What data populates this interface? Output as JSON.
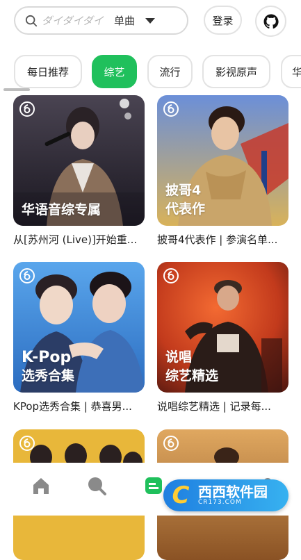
{
  "header": {
    "search_placeholder": "ダイダイダイ",
    "search_type": "单曲",
    "login_label": "登录"
  },
  "tabs": [
    {
      "label": "每日推荐"
    },
    {
      "label": "综艺",
      "active": true
    },
    {
      "label": "流行"
    },
    {
      "label": "影视原声"
    },
    {
      "label": "华"
    }
  ],
  "cards": [
    {
      "caption": "从[苏州河 (Live)]开始重...",
      "overlay_lines": [
        "华语音综专属"
      ],
      "colors": [
        "#3a3340",
        "#1d1a22"
      ]
    },
    {
      "caption": "披哥4代表作 | 参演名单...",
      "overlay_lines": [
        "披哥4",
        "代表作"
      ],
      "colors": [
        "#5a7fd0",
        "#c9a24a"
      ]
    },
    {
      "caption": "KPop选秀合集 | 恭喜男...",
      "overlay_lines": [
        "K-Pop",
        "选秀合集"
      ],
      "colors": [
        "#4d96e0",
        "#2a6cc2"
      ]
    },
    {
      "caption": "说唱综艺精选 | 记录每...",
      "overlay_lines": [
        "说唱",
        "综艺精选"
      ],
      "colors": [
        "#e04a22",
        "#7a2415"
      ]
    },
    {
      "caption": "",
      "overlay_lines": [],
      "colors": [
        "#e8b73a",
        "#c98e1f"
      ]
    },
    {
      "caption": "",
      "overlay_lines": [],
      "colors": [
        "#d99a52",
        "#9a5e2a"
      ]
    }
  ],
  "bottom_nav": [
    {
      "icon": "home-icon"
    },
    {
      "icon": "search-icon"
    },
    {
      "icon": "playlist-icon",
      "active": true
    },
    {
      "icon": "chart-icon"
    },
    {
      "icon": "profile-icon"
    }
  ],
  "watermark": {
    "brand": "西西软件园",
    "url": "CR173.COM"
  },
  "colors": {
    "accent": "#20c05c",
    "border": "#e3e3e3"
  }
}
